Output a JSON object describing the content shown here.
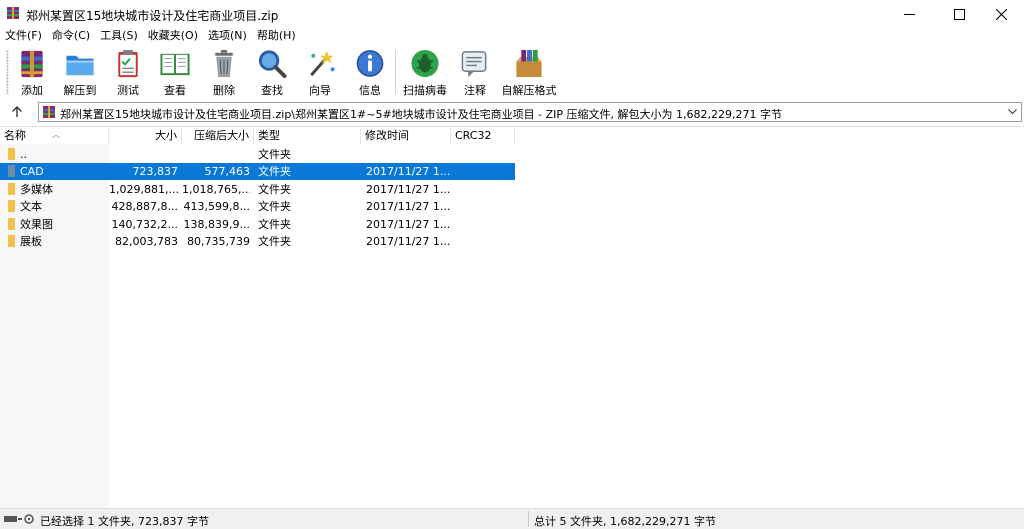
{
  "window": {
    "title": "郑州某置区15地块城市设计及住宅商业项目.zip"
  },
  "menu": [
    {
      "label": "文件(F)"
    },
    {
      "label": "命令(C)"
    },
    {
      "label": "工具(S)"
    },
    {
      "label": "收藏夹(O)"
    },
    {
      "label": "选项(N)"
    },
    {
      "label": "帮助(H)"
    }
  ],
  "toolbar": [
    {
      "label": "添加",
      "icon": "add-archive-icon"
    },
    {
      "label": "解压到",
      "icon": "extract-folder-icon"
    },
    {
      "label": "测试",
      "icon": "test-clipboard-icon"
    },
    {
      "label": "查看",
      "icon": "view-book-icon"
    },
    {
      "label": "删除",
      "icon": "trash-bin-icon"
    },
    {
      "label": "查找",
      "icon": "magnifier-icon"
    },
    {
      "label": "向导",
      "icon": "wizard-wand-icon"
    },
    {
      "label": "信息",
      "icon": "info-icon"
    },
    {
      "label": "扫描病毒",
      "icon": "virus-scan-icon"
    },
    {
      "label": "注释",
      "icon": "comment-icon"
    },
    {
      "label": "自解压格式",
      "icon": "sfx-box-icon"
    }
  ],
  "address": {
    "path": "郑州某置区15地块城市设计及住宅商业项目.zip\\郑州某置区1#~5#地块城市设计及住宅商业项目 - ZIP 压缩文件, 解包大小为 1,682,229,271 字节"
  },
  "columns": {
    "name": "名称",
    "size": "大小",
    "packed": "压缩后大小",
    "type": "类型",
    "modified": "修改时间",
    "crc": "CRC32"
  },
  "rows": [
    {
      "name": "..",
      "size": "",
      "packed": "",
      "type": "文件夹",
      "modified": "",
      "selected": false
    },
    {
      "name": "CAD",
      "size": "723,837",
      "packed": "577,463",
      "type": "文件夹",
      "modified": "2017/11/27 1...",
      "selected": true
    },
    {
      "name": "多媒体",
      "size": "1,029,881,...",
      "packed": "1,018,765,...",
      "type": "文件夹",
      "modified": "2017/11/27 1...",
      "selected": false
    },
    {
      "name": "文本",
      "size": "428,887,8...",
      "packed": "413,599,8...",
      "type": "文件夹",
      "modified": "2017/11/27 1...",
      "selected": false
    },
    {
      "name": "效果图",
      "size": "140,732,2...",
      "packed": "138,839,9...",
      "type": "文件夹",
      "modified": "2017/11/27 1...",
      "selected": false
    },
    {
      "name": "展板",
      "size": "82,003,783",
      "packed": "80,735,739",
      "type": "文件夹",
      "modified": "2017/11/27 1...",
      "selected": false
    }
  ],
  "status": {
    "left": "已经选择 1 文件夹, 723,837 字节",
    "right": "总计 5 文件夹, 1,682,229,271 字节"
  },
  "colors": {
    "selection": "#0a78d7",
    "folder": "#f3c14b"
  }
}
